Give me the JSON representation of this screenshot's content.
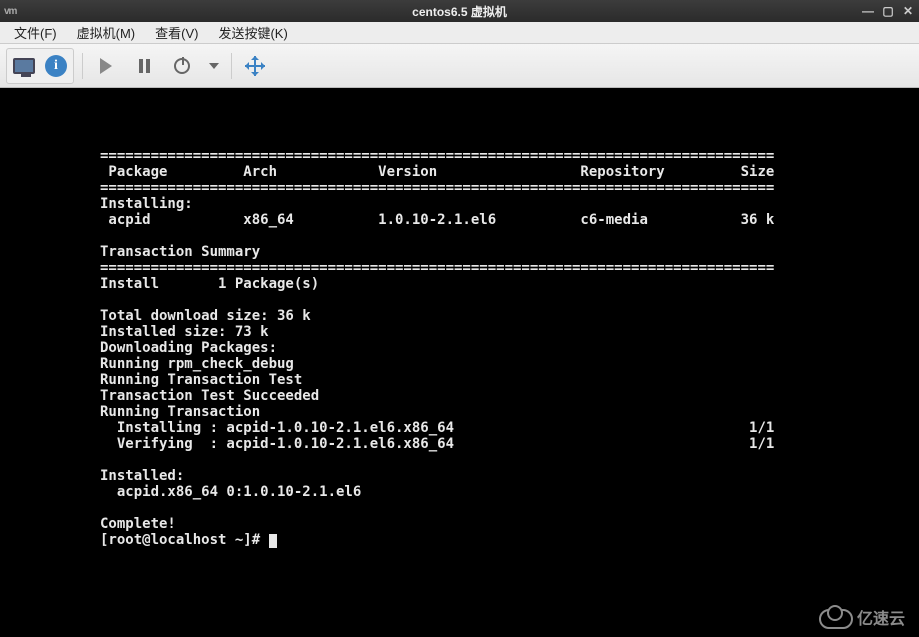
{
  "window": {
    "title": "centos6.5 虚拟机",
    "app_icon_text": "vm"
  },
  "menubar": {
    "items": [
      {
        "label": "文件(F)"
      },
      {
        "label": "虚拟机(M)"
      },
      {
        "label": "查看(V)"
      },
      {
        "label": "发送按键(K)"
      }
    ]
  },
  "terminal": {
    "divider": "================================================================================",
    "header": {
      "package": "Package",
      "arch": "Arch",
      "version": "Version",
      "repository": "Repository",
      "size": "Size"
    },
    "installing_label": "Installing:",
    "row": {
      "package": "acpid",
      "arch": "x86_64",
      "version": "1.0.10-2.1.el6",
      "repository": "c6-media",
      "size": "36 k"
    },
    "tx_summary_label": "Transaction Summary",
    "install_count_line": "Install       1 Package(s)",
    "lines": [
      "",
      "Total download size: 36 k",
      "Installed size: 73 k",
      "Downloading Packages:",
      "Running rpm_check_debug",
      "Running Transaction Test",
      "Transaction Test Succeeded",
      "Running Transaction"
    ],
    "install_step": "  Installing : acpid-1.0.10-2.1.el6.x86_64",
    "verify_step": "  Verifying  : acpid-1.0.10-2.1.el6.x86_64",
    "step_progress": "1/1",
    "installed_label": "Installed:",
    "installed_pkg": "  acpid.x86_64 0:1.0.10-2.1.el6",
    "complete_label": "Complete!",
    "prompt": "[root@localhost ~]# "
  },
  "watermark": {
    "text": "亿速云"
  }
}
